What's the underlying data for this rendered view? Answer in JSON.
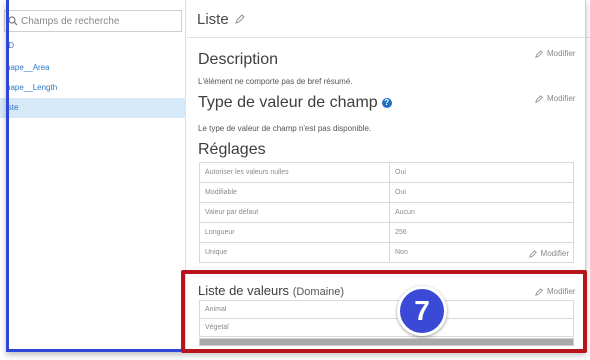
{
  "sidebar": {
    "search_placeholder": "Champs de recherche",
    "items": [
      {
        "label": "ID"
      },
      {
        "label": "hape__Area"
      },
      {
        "label": "hape__Length"
      },
      {
        "label": "iste"
      }
    ]
  },
  "main": {
    "title": "Liste",
    "description": {
      "heading": "Description",
      "text": "L'élément ne comporte pas de bref résumé.",
      "modify": "Modifier"
    },
    "field_value_type": {
      "heading": "Type de valeur de champ",
      "info_icon": "info-icon",
      "text": "Le type de valeur de champ n'est pas disponible.",
      "modify": "Modifier"
    },
    "settings": {
      "heading": "Réglages",
      "rows": [
        {
          "key": "Autoriser les valeurs nulles",
          "value": "Oui"
        },
        {
          "key": "Modifiable",
          "value": "Oui"
        },
        {
          "key": "Valeur par défaut",
          "value": "Aucun"
        },
        {
          "key": "Longueur",
          "value": "256"
        },
        {
          "key": "Unique",
          "value": "Non"
        }
      ],
      "modify": "Modifier"
    },
    "domain": {
      "heading": "Liste de valeurs",
      "subheading": "(Domaine)",
      "modify": "Modifier",
      "values": [
        "Animal",
        "Végetal"
      ]
    }
  },
  "annotation": {
    "badge_number": "7",
    "highlight_color": "#b8141b",
    "badge_color": "#3a49d6"
  },
  "colors": {
    "accent": "#2f46d6",
    "link": "#2b78c2",
    "selected_bg": "#d6e9f8"
  }
}
